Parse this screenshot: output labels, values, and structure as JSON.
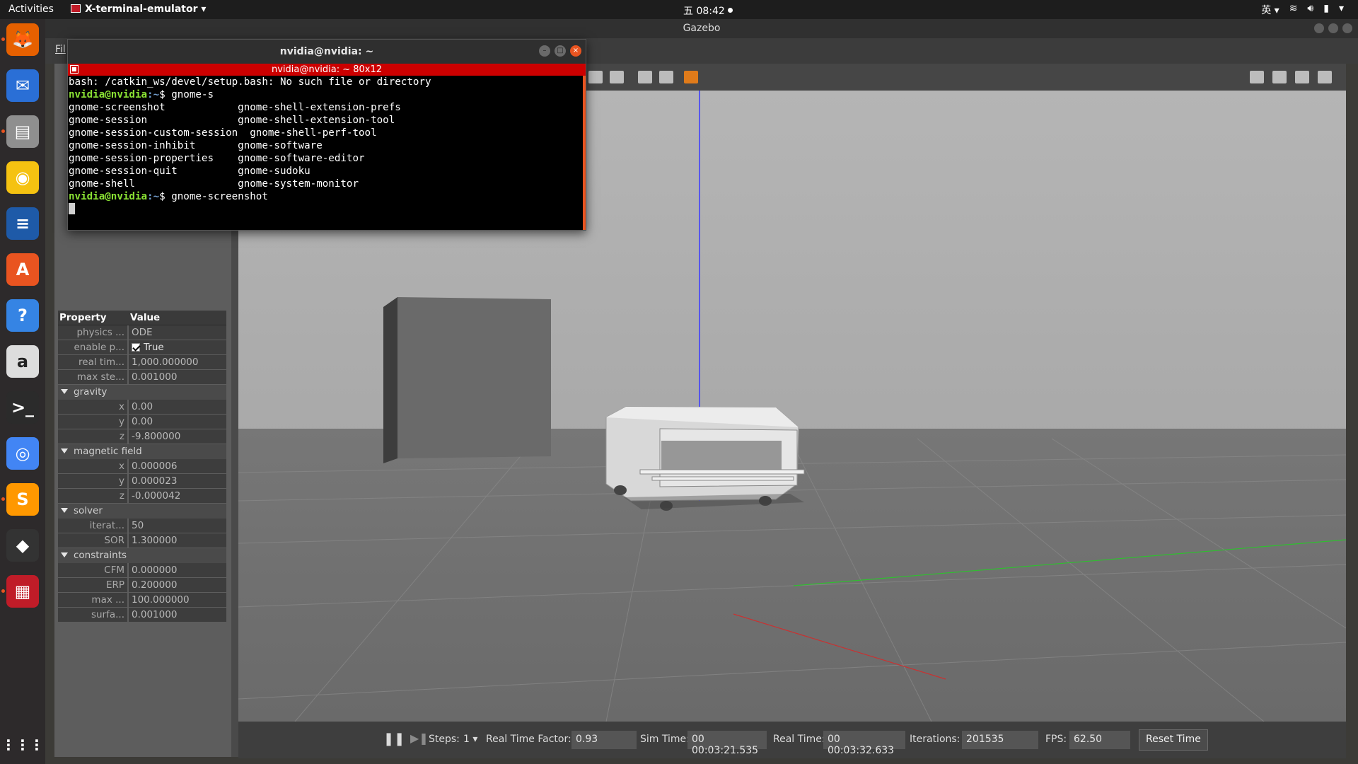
{
  "topbar": {
    "activities": "Activities",
    "app_name": "X-terminal-emulator",
    "clock": "五 08:42",
    "input_method": "英"
  },
  "gazebo": {
    "window_title": "Gazebo",
    "menu_file": "Fil",
    "properties": {
      "header_property": "Property",
      "header_value": "Value",
      "rows": [
        {
          "type": "prop",
          "name": "physics ...",
          "value": "ODE"
        },
        {
          "type": "check",
          "name": "enable p...",
          "value": "True"
        },
        {
          "type": "prop",
          "name": "real tim...",
          "value": "1,000.000000"
        },
        {
          "type": "prop",
          "name": "max ste...",
          "value": "0.001000"
        },
        {
          "type": "group",
          "name": "gravity"
        },
        {
          "type": "prop",
          "name": "x",
          "value": "0.00"
        },
        {
          "type": "prop",
          "name": "y",
          "value": "0.00"
        },
        {
          "type": "prop",
          "name": "z",
          "value": "-9.800000"
        },
        {
          "type": "group",
          "name": "magnetic field"
        },
        {
          "type": "prop",
          "name": "x",
          "value": "0.000006"
        },
        {
          "type": "prop",
          "name": "y",
          "value": "0.000023"
        },
        {
          "type": "prop",
          "name": "z",
          "value": "-0.000042"
        },
        {
          "type": "group",
          "name": "solver"
        },
        {
          "type": "prop",
          "name": "iterat...",
          "value": "50"
        },
        {
          "type": "prop",
          "name": "SOR",
          "value": "1.300000"
        },
        {
          "type": "group",
          "name": "constraints"
        },
        {
          "type": "prop",
          "name": "CFM",
          "value": "0.000000"
        },
        {
          "type": "prop",
          "name": "ERP",
          "value": "0.200000"
        },
        {
          "type": "prop",
          "name": "max ...",
          "value": "100.000000"
        },
        {
          "type": "prop",
          "name": "surfa...",
          "value": "0.001000"
        }
      ]
    },
    "bottom": {
      "steps_label": "Steps:",
      "steps_value": "1",
      "rtf_label": "Real Time Factor:",
      "rtf_value": "0.93",
      "sim_time_label": "Sim Time:",
      "sim_time_value": "00 00:03:21.535",
      "real_time_label": "Real Time:",
      "real_time_value": "00 00:03:32.633",
      "iterations_label": "Iterations:",
      "iterations_value": "201535",
      "fps_label": "FPS:",
      "fps_value": "62.50",
      "reset_button": "Reset Time"
    }
  },
  "terminal": {
    "title": "nvidia@nvidia: ~",
    "subtitle": "nvidia@nvidia: ~ 80x12",
    "lines": [
      {
        "kind": "text",
        "text": "bash: /catkin_ws/devel/setup.bash: No such file or directory"
      },
      {
        "kind": "prompt",
        "user": "nvidia@nvidia",
        "path": ":~",
        "cmd": "$ gnome-s"
      },
      {
        "kind": "text",
        "text": "gnome-screenshot            gnome-shell-extension-prefs"
      },
      {
        "kind": "text",
        "text": "gnome-session               gnome-shell-extension-tool"
      },
      {
        "kind": "text",
        "text": "gnome-session-custom-session  gnome-shell-perf-tool"
      },
      {
        "kind": "text",
        "text": "gnome-session-inhibit       gnome-software"
      },
      {
        "kind": "text",
        "text": "gnome-session-properties    gnome-software-editor"
      },
      {
        "kind": "text",
        "text": "gnome-session-quit          gnome-sudoku"
      },
      {
        "kind": "text",
        "text": "gnome-shell                 gnome-system-monitor"
      },
      {
        "kind": "prompt",
        "user": "nvidia@nvidia",
        "path": ":~",
        "cmd": "$ gnome-screenshot"
      }
    ]
  },
  "dock": {
    "items": [
      {
        "icon": "firefox-icon",
        "color": "#e66000",
        "running": true
      },
      {
        "icon": "thunderbird-icon",
        "color": "#2a6fd6",
        "running": false
      },
      {
        "icon": "files-icon",
        "color": "#8f8f8f",
        "running": true
      },
      {
        "icon": "rhythmbox-icon",
        "color": "#f5c211",
        "running": false
      },
      {
        "icon": "writer-icon",
        "color": "#1e5aa8",
        "running": false
      },
      {
        "icon": "software-icon",
        "color": "#e95420",
        "running": false
      },
      {
        "icon": "help-icon",
        "color": "#3584e4",
        "running": false
      },
      {
        "icon": "amazon-icon",
        "color": "#dddddd",
        "running": false
      },
      {
        "icon": "terminal-icon",
        "color": "#2b2b2b",
        "running": false
      },
      {
        "icon": "chrome-icon",
        "color": "#4285f4",
        "running": false
      },
      {
        "icon": "sublime-icon",
        "color": "#ff9800",
        "running": true
      },
      {
        "icon": "books-icon",
        "color": "#333333",
        "running": false
      },
      {
        "icon": "xterm-icon",
        "color": "#c01c28",
        "running": true
      }
    ]
  }
}
